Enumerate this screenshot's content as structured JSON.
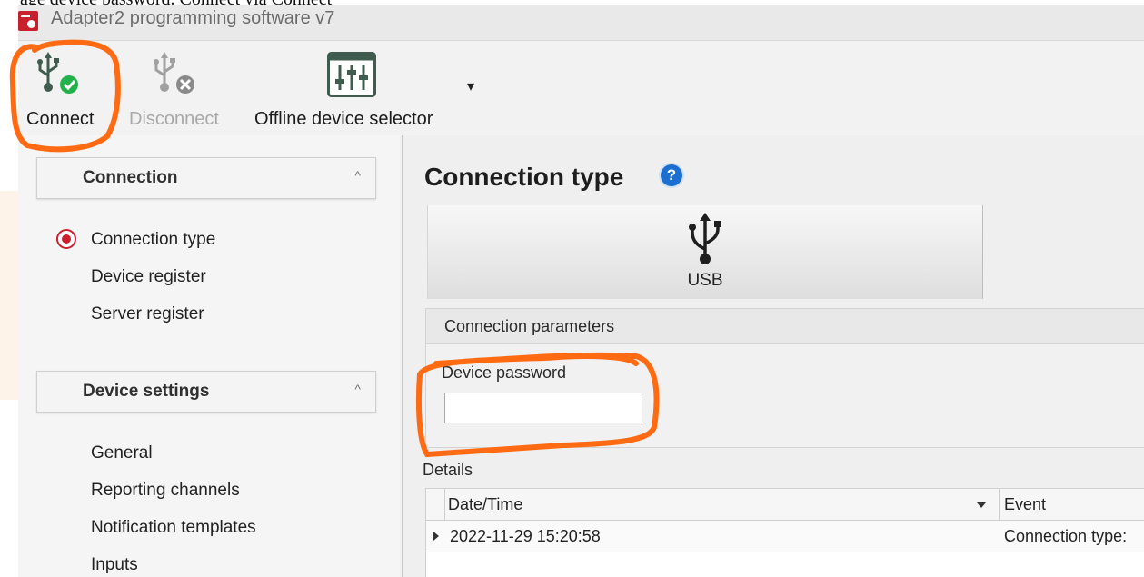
{
  "document": {
    "top_text": "age device password. Connect via Connect"
  },
  "window": {
    "title": "Adapter2 programming software v7"
  },
  "toolbar": {
    "connect_label": "Connect",
    "disconnect_label": "Disconnect",
    "offline_label": "Offline device selector",
    "dropdown_glyph": "▾"
  },
  "sidebar": {
    "groups": [
      {
        "title": "Connection",
        "chevron": "^",
        "items": [
          "Connection type",
          "Device register",
          "Server register"
        ]
      },
      {
        "title": "Device settings",
        "chevron": "^",
        "items": [
          "General",
          "Reporting channels",
          "Notification templates",
          "Inputs"
        ]
      }
    ],
    "selected_item": "Connection type"
  },
  "main": {
    "title": "Connection type",
    "help_glyph": "?",
    "connection_option": {
      "label": "USB",
      "icon": "usb-icon"
    },
    "params": {
      "header": "Connection parameters",
      "password_label": "Device password",
      "password_value": ""
    },
    "details": {
      "label": "Details",
      "columns": [
        "Date/Time",
        "Event"
      ],
      "rows": [
        {
          "datetime": "2022-11-29 15:20:58",
          "event": "Connection type:"
        }
      ]
    }
  },
  "colors": {
    "accent_red": "#c8202c",
    "help_blue": "#1a6fd0",
    "annotation_orange": "#ff6a13",
    "connect_green": "#22b24c"
  }
}
